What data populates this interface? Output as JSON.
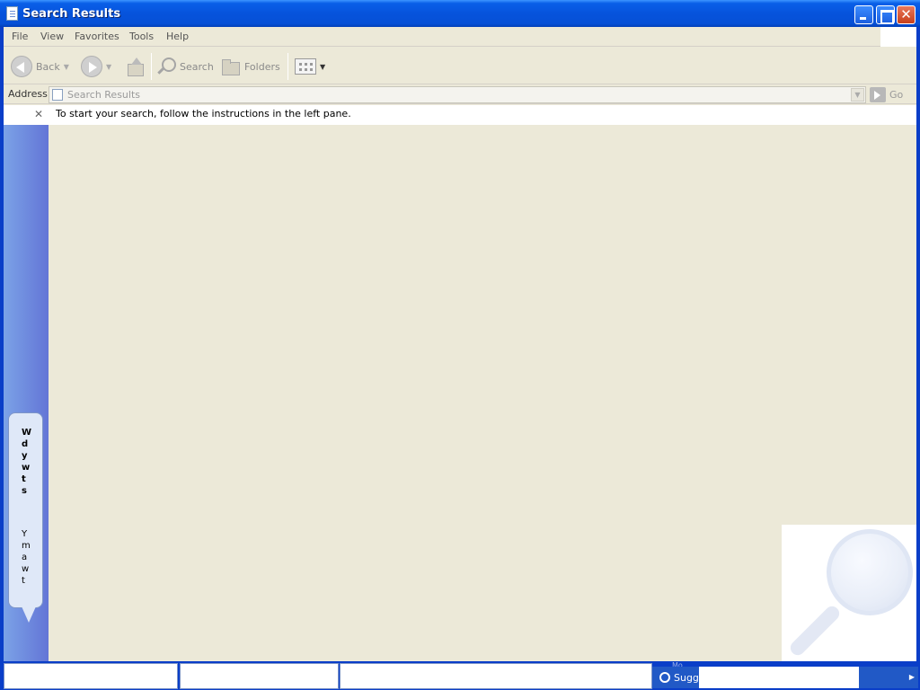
{
  "window": {
    "title": "Search Results",
    "close_glyph": "✕"
  },
  "menubar": {
    "items": [
      "File",
      "View",
      "Favorites",
      "Tools",
      "Help"
    ]
  },
  "toolbar": {
    "back_label": "Back",
    "search_label": "Search",
    "folders_label": "Folders",
    "dropdown_glyph": "▼"
  },
  "address": {
    "label": "Address",
    "value": "Search Results",
    "go_label": "Go"
  },
  "content": {
    "pane_close_glyph": "✕",
    "instructions": "To start your search, follow the instructions in the left pane."
  },
  "assistant": {
    "lines_bold": [
      "W",
      "d",
      "y",
      "w",
      "t",
      "s"
    ],
    "lines_normal": [
      "Y",
      "m",
      "a",
      "w",
      "t"
    ]
  },
  "bottom": {
    "more_label": "Mo",
    "suggest_label": "Sugg",
    "arrow_glyph": "▶"
  },
  "colors": {
    "title_bar": "#0653dc",
    "window_bg": "#ece9d8",
    "left_pane": "#7ba2e7"
  }
}
